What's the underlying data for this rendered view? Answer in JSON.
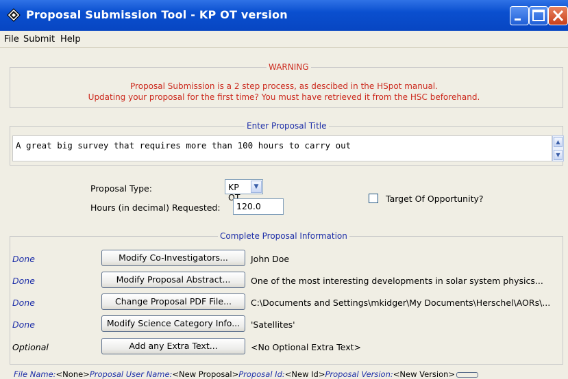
{
  "window": {
    "title": "Proposal Submission Tool - KP OT version"
  },
  "menu": [
    "File",
    "Submit",
    "Help"
  ],
  "warning": {
    "legend": "WARNING",
    "line1": "Proposal Submission is a 2 step process, as descibed in the HSpot manual.",
    "line2": "Updating your proposal for the first time? You must have retrieved it from the HSC beforehand."
  },
  "title_section": {
    "legend": "Enter Proposal Title",
    "value": "A great big survey that requires more than 100 hours to carry out"
  },
  "proposal": {
    "type_label": "Proposal Type:",
    "type_value": "KP OT",
    "hours_label": "Hours (in decimal) Requested:",
    "hours_value": "120.0",
    "too_label": "Target Of Opportunity?"
  },
  "info_section": {
    "legend": "Complete Proposal Information",
    "rows": [
      {
        "status": "Done",
        "button": "Modify Co-Investigators...",
        "info": "John Doe"
      },
      {
        "status": "Done",
        "button": "Modify Proposal Abstract...",
        "info": "One of the most interesting developments in solar system physics..."
      },
      {
        "status": "Done",
        "button": "Change Proposal PDF File...",
        "info": "C:\\Documents and Settings\\mkidger\\My Documents\\Herschel\\AORs\\..."
      },
      {
        "status": "Done",
        "button": "Modify Science Category Info...",
        "info": "'Satellites'"
      },
      {
        "status": "Optional",
        "button": "Add any Extra Text...",
        "info": "<No Optional Extra Text>"
      }
    ]
  },
  "statusbar": {
    "file_name_key": "File Name:",
    "file_name_val": "<None>",
    "user_name_key": "Proposal User Name:",
    "user_name_val": "<New Proposal>",
    "id_key": "Proposal Id:",
    "id_val": "<New Id>",
    "version_key": "Proposal Version:",
    "version_val": "<New Version>"
  },
  "colors": {
    "titlebar": "#0a4fcf",
    "warning": "#cc2a1e",
    "status_done": "#1e2fa8",
    "legend": "#1e2fa8"
  },
  "icons": [
    "app-icon",
    "minimize-icon",
    "maximize-icon",
    "close-icon",
    "scroll-up-icon",
    "scroll-down-icon",
    "dropdown-arrow-icon"
  ]
}
